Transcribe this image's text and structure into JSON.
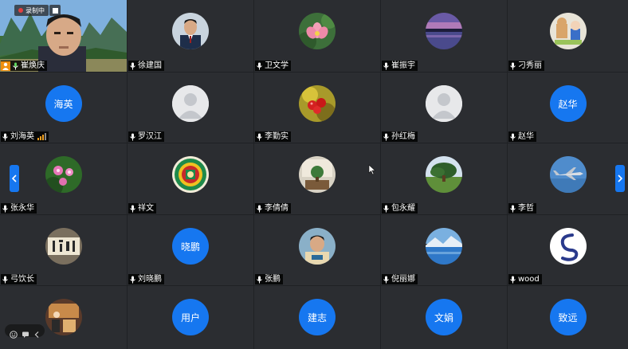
{
  "colors": {
    "background": "#1f2124",
    "tile": "#2b2d31",
    "accent": "#1677f0",
    "label_bg": "#000000",
    "signal": "#f0a020"
  },
  "recording": {
    "label": "录制中"
  },
  "host": {
    "name": "崔焕庆",
    "role_icon": "host-icon"
  },
  "participants": [
    {
      "name": "徐建国",
      "avatar": "photo-man-suit"
    },
    {
      "name": "卫文学",
      "avatar": "photo-lotus"
    },
    {
      "name": "崔振宇",
      "avatar": "photo-sunset-lake"
    },
    {
      "name": "刁秀丽",
      "avatar": "photo-cartoon"
    },
    {
      "name": "刘海英",
      "avatar_text": "海英",
      "signal": true
    },
    {
      "name": "罗汉江",
      "avatar": "generic-user"
    },
    {
      "name": "李勤实",
      "avatar": "photo-fruit"
    },
    {
      "name": "孙红梅",
      "avatar": "generic-user"
    },
    {
      "name": "赵华",
      "avatar_text": "赵华"
    },
    {
      "name": "张永华",
      "avatar": "photo-flowers"
    },
    {
      "name": "祥文",
      "avatar": "photo-mandala"
    },
    {
      "name": "李倩倩",
      "avatar": "photo-room"
    },
    {
      "name": "包永耀",
      "avatar": "photo-tree"
    },
    {
      "name": "李哲",
      "avatar": "photo-jet"
    },
    {
      "name": "弓饮长",
      "avatar": "photo-calligraphy"
    },
    {
      "name": "刘晓鹏",
      "avatar_text": "晓鹏"
    },
    {
      "name": "张鹏",
      "avatar": "photo-person"
    },
    {
      "name": "倪丽娜",
      "avatar": "photo-lake-mountain"
    },
    {
      "name": "wood",
      "avatar": "photo-logo"
    },
    {
      "name": "",
      "avatar": "photo-shop"
    },
    {
      "name": "",
      "avatar_text": "用户"
    },
    {
      "name": "",
      "avatar_text": "建志"
    },
    {
      "name": "",
      "avatar_text": "文娟"
    },
    {
      "name": "",
      "avatar_text": "致远"
    }
  ]
}
